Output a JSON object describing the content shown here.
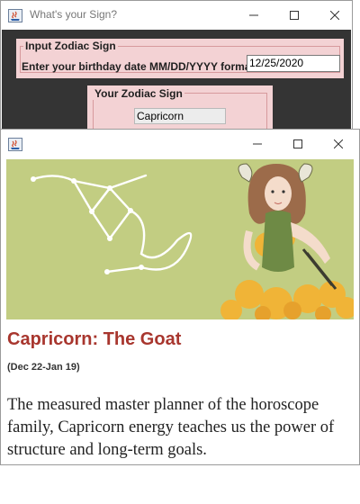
{
  "back_window": {
    "title": "What's your Sign?",
    "input_group": {
      "label": "Input Zodiac Sign",
      "field_label": "Enter your birthday date MM/DD/YYYY format:",
      "field_value": "12/25/2020"
    },
    "output_group": {
      "label": "Your Zodiac Sign",
      "value": "Capricorn"
    }
  },
  "front_window": {
    "title": "",
    "heading": "Capricorn: The Goat",
    "dates": "(Dec 22-Jan 19)",
    "description": "The measured master planner of the horoscope family, Capricorn energy teaches us the power of structure and long-term goals."
  },
  "colors": {
    "accent_heading": "#a8362e",
    "hero_background": "#c2cd82",
    "panel_pink": "#f3d2d4",
    "window_body_dark": "#343434"
  },
  "icons": [
    "java-app-icon",
    "minimize-icon",
    "maximize-icon",
    "close-icon",
    "capricorn-constellation-icon"
  ]
}
